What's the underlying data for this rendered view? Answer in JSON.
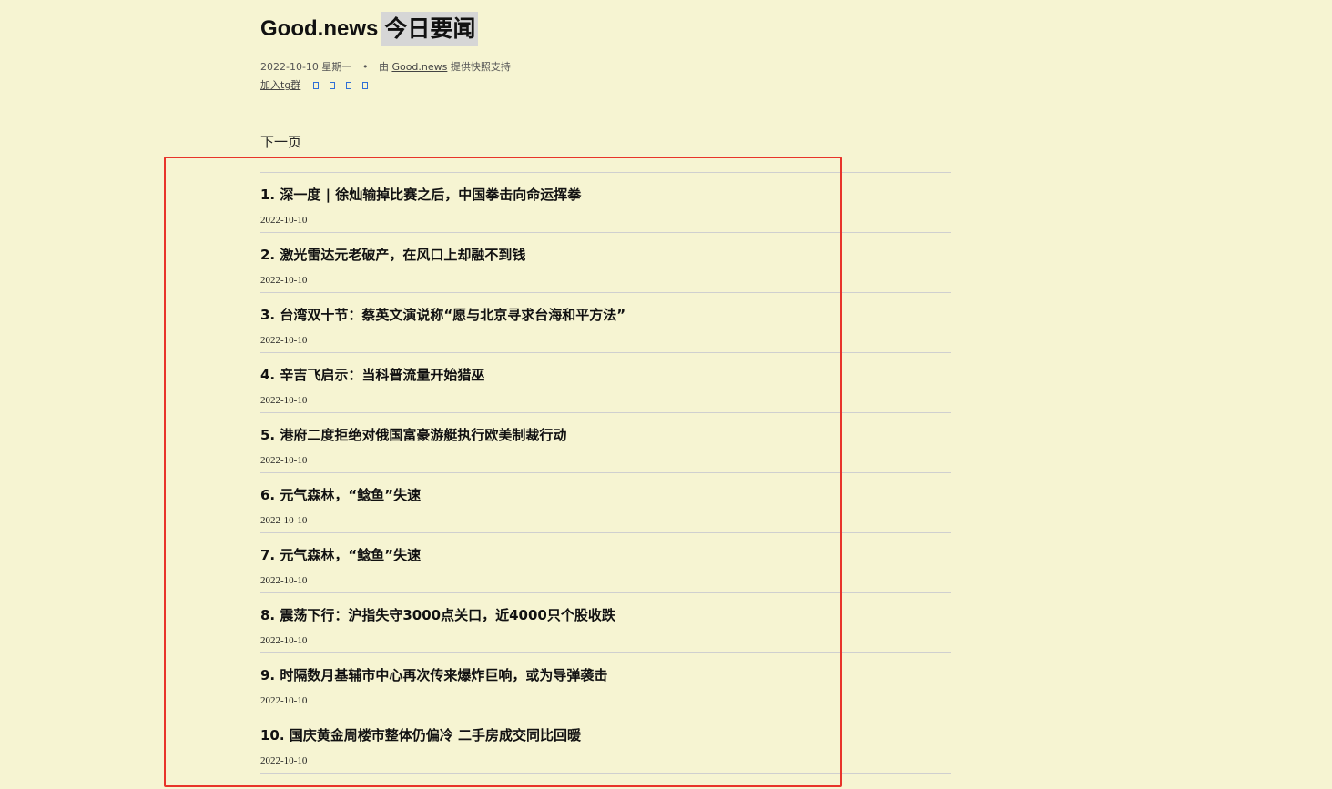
{
  "header": {
    "brand": "Good.news",
    "highlight": "今日要闻"
  },
  "meta": {
    "date": "2022-10-10 星期一",
    "dot": "•",
    "by": "由",
    "provider_link": "Good.news",
    "suffix": "提供快照支持"
  },
  "links": {
    "join_tg": "加入tg群"
  },
  "nav": {
    "next_page": "下一页"
  },
  "news": [
    {
      "title": "1. 深一度 | 徐灿输掉比赛之后，中国拳击向命运挥拳",
      "date": "2022-10-10"
    },
    {
      "title": "2. 激光雷达元老破产，在风口上却融不到钱",
      "date": "2022-10-10"
    },
    {
      "title": "3. 台湾双十节：蔡英文演说称“愿与北京寻求台海和平方法”",
      "date": "2022-10-10"
    },
    {
      "title": "4. 辛吉飞启示：当科普流量开始猎巫",
      "date": "2022-10-10"
    },
    {
      "title": "5. 港府二度拒绝对俄国富豪游艇执行欧美制裁行动",
      "date": "2022-10-10"
    },
    {
      "title": "6. 元气森林，“鲶鱼”失速",
      "date": "2022-10-10"
    },
    {
      "title": "7. 元气森林，“鲶鱼”失速",
      "date": "2022-10-10"
    },
    {
      "title": "8. 震荡下行：沪指失守3000点关口，近4000只个股收跌",
      "date": "2022-10-10"
    },
    {
      "title": "9. 时隔数月基辅市中心再次传来爆炸巨响，或为导弹袭击",
      "date": "2022-10-10"
    },
    {
      "title": "10. 国庆黄金周楼市整体仍偏冷 二手房成交同比回暖",
      "date": "2022-10-10"
    }
  ],
  "colors": {
    "background": "#f6f4d2",
    "annotation_box": "#e8342a",
    "icon_blue": "#2f6fd6"
  }
}
